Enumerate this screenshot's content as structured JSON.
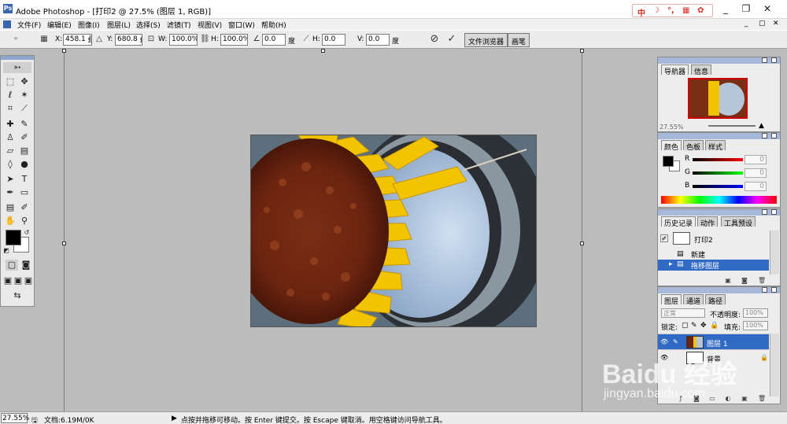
{
  "window": {
    "app_name": "Adobe Photoshop",
    "document_title": "Adobe Photoshop - [打印2 @ 27.5% (图层 1, RGB)]",
    "controls": [
      "_",
      "❐",
      "✕"
    ]
  },
  "ime_toolbar": {
    "chars": [
      "中",
      "☽",
      "°,",
      "▦",
      "✿"
    ]
  },
  "menu": {
    "items": [
      "文件(F)",
      "编辑(E)",
      "图像(I)",
      "图层(L)",
      "选择(S)",
      "滤镜(T)",
      "视图(V)",
      "窗口(W)",
      "帮助(H)"
    ],
    "right_icons": [
      "_",
      "▢",
      "✕"
    ]
  },
  "options": {
    "x_label": "X:",
    "x_value": "458.1 ∯",
    "y_label": "Y:",
    "y_value": "680.8 ∯",
    "w_label": "W:",
    "w_value": "100.0%",
    "h_label": "H:",
    "h_value": "100.0%",
    "angle_value": "0.0",
    "angle_unit": "度",
    "hskew_label": "H:",
    "hskew_value": "0.0",
    "vskew_label": "V:",
    "vskew_value": "0.0",
    "skew_unit": "度",
    "cancel_icon": "⊘",
    "commit_icon": "✓",
    "tab_file_browser": "文件浏览器",
    "tab_brushes": "画笔"
  },
  "palettes": {
    "navigator": {
      "tabs": [
        "导航器",
        "信息"
      ],
      "zoom": "27.55%"
    },
    "color": {
      "tabs": [
        "颜色",
        "色板",
        "样式"
      ],
      "channels": [
        {
          "label": "R",
          "value": "0",
          "color": "#d00000"
        },
        {
          "label": "G",
          "value": "0",
          "color": "#00b000"
        },
        {
          "label": "B",
          "value": "0",
          "color": "#0000d0"
        }
      ]
    },
    "history": {
      "tabs": [
        "历史记录",
        "动作",
        "工具预设"
      ],
      "snapshot": "打印2",
      "steps": [
        "新建",
        "拖移图层"
      ]
    },
    "layers": {
      "tabs": [
        "图层",
        "通道",
        "路径"
      ],
      "blend_mode": "正常",
      "opacity_label": "不透明度:",
      "opacity_value": "100%",
      "lock_label": "锁定:",
      "fill_label": "填充:",
      "fill_value": "100%",
      "layers": [
        {
          "name": "图层 1",
          "selected": true
        },
        {
          "name": "背景",
          "selected": false
        }
      ]
    }
  },
  "status": {
    "zoom": "27.55%",
    "doc_info": "文档:6.19M/0K",
    "hint": "点按并拖移可移动。按 Enter 键提交。按 Escape 键取消。用空格键访问导航工具。"
  },
  "watermark": {
    "brand": "Baidu 经验",
    "url": "jingyan.baidu.com"
  },
  "colors": {
    "selection": "#316ac5",
    "palette_header": "#a7b8d8",
    "canvas_bg": "#bcbcbc"
  }
}
